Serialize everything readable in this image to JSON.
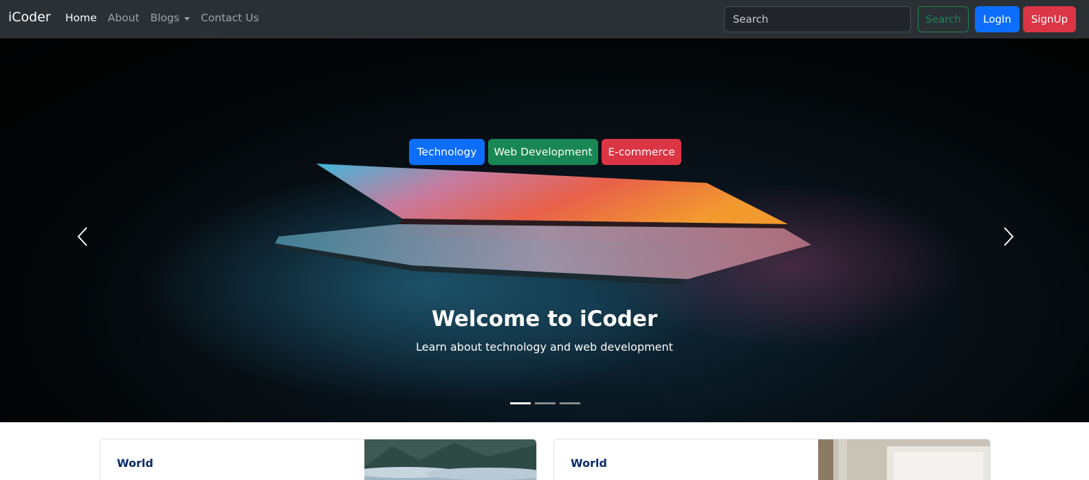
{
  "navbar": {
    "brand": "iCoder",
    "links": [
      {
        "label": "Home",
        "active": true
      },
      {
        "label": "About"
      },
      {
        "label": "Blogs",
        "dropdown": true
      },
      {
        "label": "Contact Us"
      }
    ],
    "search_placeholder": "Search",
    "search_button": "Search",
    "login_button": "LogIn",
    "signup_button": "SignUp"
  },
  "hero": {
    "title": "Welcome to iCoder",
    "subtitle": "Learn about technology and web development",
    "buttons": [
      "Technology",
      "Web Development",
      "E-commerce"
    ],
    "slide_count": 3,
    "active_slide": 1,
    "prev_icon": "chevron-left-icon",
    "next_icon": "chevron-right-icon"
  },
  "cards": [
    {
      "category": "World"
    },
    {
      "category": "World"
    }
  ],
  "colors": {
    "navbar_bg": "#2b3035",
    "primary": "#0d6efd",
    "success": "#198754",
    "danger": "#dc3545",
    "card_category": "#0a2a6b"
  }
}
